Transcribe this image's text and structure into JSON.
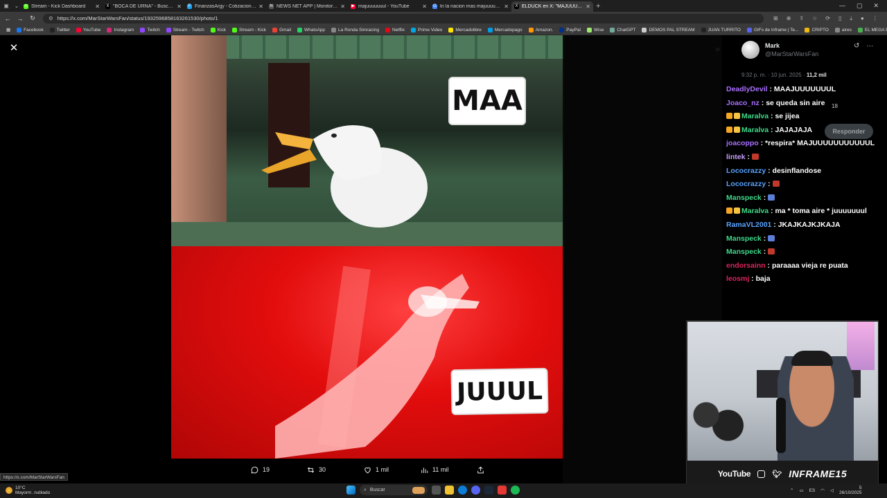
{
  "browser": {
    "tabs": [
      {
        "title": "Stream - Kick Dashboard",
        "fav": "#53fc18",
        "glyph": "K"
      },
      {
        "title": "\"BOCA DE URNA\" - Buscar / X",
        "fav": "#000",
        "glyph": "X"
      },
      {
        "title": "FinanzasArgy - Cotizaciones en ti...",
        "fav": "#1da1f2",
        "glyph": "F"
      },
      {
        "title": "NEWS NET APP | Monitoreo de n...",
        "fav": "#555",
        "glyph": "N"
      },
      {
        "title": "majuuuuuuul - YouTube",
        "fav": "#ff0033",
        "glyph": "▶"
      },
      {
        "title": "tn la nacion mas majuuuuuuul",
        "fav": "#4285f4",
        "glyph": "G"
      },
      {
        "title": "ELDUCK en X: \"MAJUUUUUL http...",
        "fav": "#000",
        "glyph": "X",
        "active": true
      }
    ],
    "url": "https://x.com/MarStarWarsFan/status/1932596858163261530/photo/1",
    "bookmarks": [
      {
        "label": "Facebook",
        "color": "#1877f2"
      },
      {
        "label": "Twitter",
        "color": "#222"
      },
      {
        "label": "YouTube",
        "color": "#ff0033"
      },
      {
        "label": "Instagram",
        "color": "#d62976"
      },
      {
        "label": "Twitch",
        "color": "#9146ff"
      },
      {
        "label": "Stream - Twitch",
        "color": "#9146ff"
      },
      {
        "label": "Kick",
        "color": "#53fc18"
      },
      {
        "label": "Stream - Kick",
        "color": "#53fc18"
      },
      {
        "label": "Gmail",
        "color": "#ea4335"
      },
      {
        "label": "WhatsApp",
        "color": "#25d366"
      },
      {
        "label": "La Ronda Simracing",
        "color": "#888"
      },
      {
        "label": "Netflix",
        "color": "#e50914"
      },
      {
        "label": "Prime Video",
        "color": "#00a8e1"
      },
      {
        "label": "Mercadolibre",
        "color": "#ffe600"
      },
      {
        "label": "Mercadopago",
        "color": "#009ee3"
      },
      {
        "label": "Amazon.",
        "color": "#ff9900"
      },
      {
        "label": "PayPal",
        "color": "#003087"
      },
      {
        "label": "Wise",
        "color": "#9fe870"
      },
      {
        "label": "ChatGPT",
        "color": "#74aa9c"
      },
      {
        "label": "DEMOS PAL STREAM",
        "color": "#ccc"
      },
      {
        "label": "JUAN TURRITO",
        "color": "#222"
      },
      {
        "label": "GIFs de Inframe | Te...",
        "color": "#5865f2"
      },
      {
        "label": "CRIPTO",
        "color": "#f0b90b"
      },
      {
        "label": "aires",
        "color": "#888"
      },
      {
        "label": "EL MEGA PACK PAP...",
        "color": "#4caf50"
      }
    ]
  },
  "photo": {
    "caption_top": "MAA",
    "caption_bottom": "JUUUL"
  },
  "actions": {
    "replies": "19",
    "reposts": "30",
    "likes": "1 mil",
    "views": "11 mil"
  },
  "tweet": {
    "author_name": "Mark",
    "author_handle": "@MarStarWarsFan",
    "time": "9:32 p. m. · 10 jun. 2025 ·",
    "views": "11,2 mil",
    "bookmark_count": "18",
    "reply_label": "Responder"
  },
  "chat": [
    {
      "user": "DeadlyDevil",
      "color": "#a970ff",
      "text": "MAAJUUUUUUUL"
    },
    {
      "user": "Joaco_nz",
      "color": "#a970ff",
      "text": "se queda sin aire"
    },
    {
      "user": "Maralva",
      "color": "#3fd98a",
      "text": "se jijea",
      "badges": true
    },
    {
      "user": "Maralva",
      "color": "#3fd98a",
      "text": "JAJAJAJA",
      "badges": true
    },
    {
      "user": "joacoppo",
      "color": "#a970ff",
      "text": "*respira* MAJUUUUUUUUUUUL"
    },
    {
      "user": "lintek",
      "color": "#c9a0ff",
      "text": "",
      "emote": "#c0392b"
    },
    {
      "user": "Lococrazzy",
      "color": "#5aa3ff",
      "text": "desinflandose"
    },
    {
      "user": "Lococrazzy",
      "color": "#5aa3ff",
      "text": "",
      "emote": "#c0392b"
    },
    {
      "user": "Manspeck",
      "color": "#3fd98a",
      "text": "",
      "emote": "#5b7fd6"
    },
    {
      "user": "Maralva",
      "color": "#3fd98a",
      "text": "ma * toma aire * juuuuuuul",
      "badges": true
    },
    {
      "user": "RamaVL2001",
      "color": "#5aa3ff",
      "text": "JKAJKAJKJKAJA"
    },
    {
      "user": "Manspeck",
      "color": "#3fd98a",
      "text": "",
      "emote": "#5b7fd6"
    },
    {
      "user": "Manspeck",
      "color": "#3fd98a",
      "text": "",
      "emote": "#c0392b"
    },
    {
      "user": "endorsainn",
      "color": "#e0245e",
      "text": "paraaaa vieja re puata"
    },
    {
      "user": "leosmj",
      "color": "#e0245e",
      "text": "baja"
    }
  ],
  "webcam": {
    "youtube": "YouTube",
    "brand": "INFRAME15"
  },
  "status_url": "https://x.com/MarStarWarsFan",
  "taskbar": {
    "temp": "10°C",
    "weather": "Mayorm. nublado",
    "search": "Buscar",
    "lang": "ES",
    "time": "5",
    "date": "26/10/2025"
  }
}
